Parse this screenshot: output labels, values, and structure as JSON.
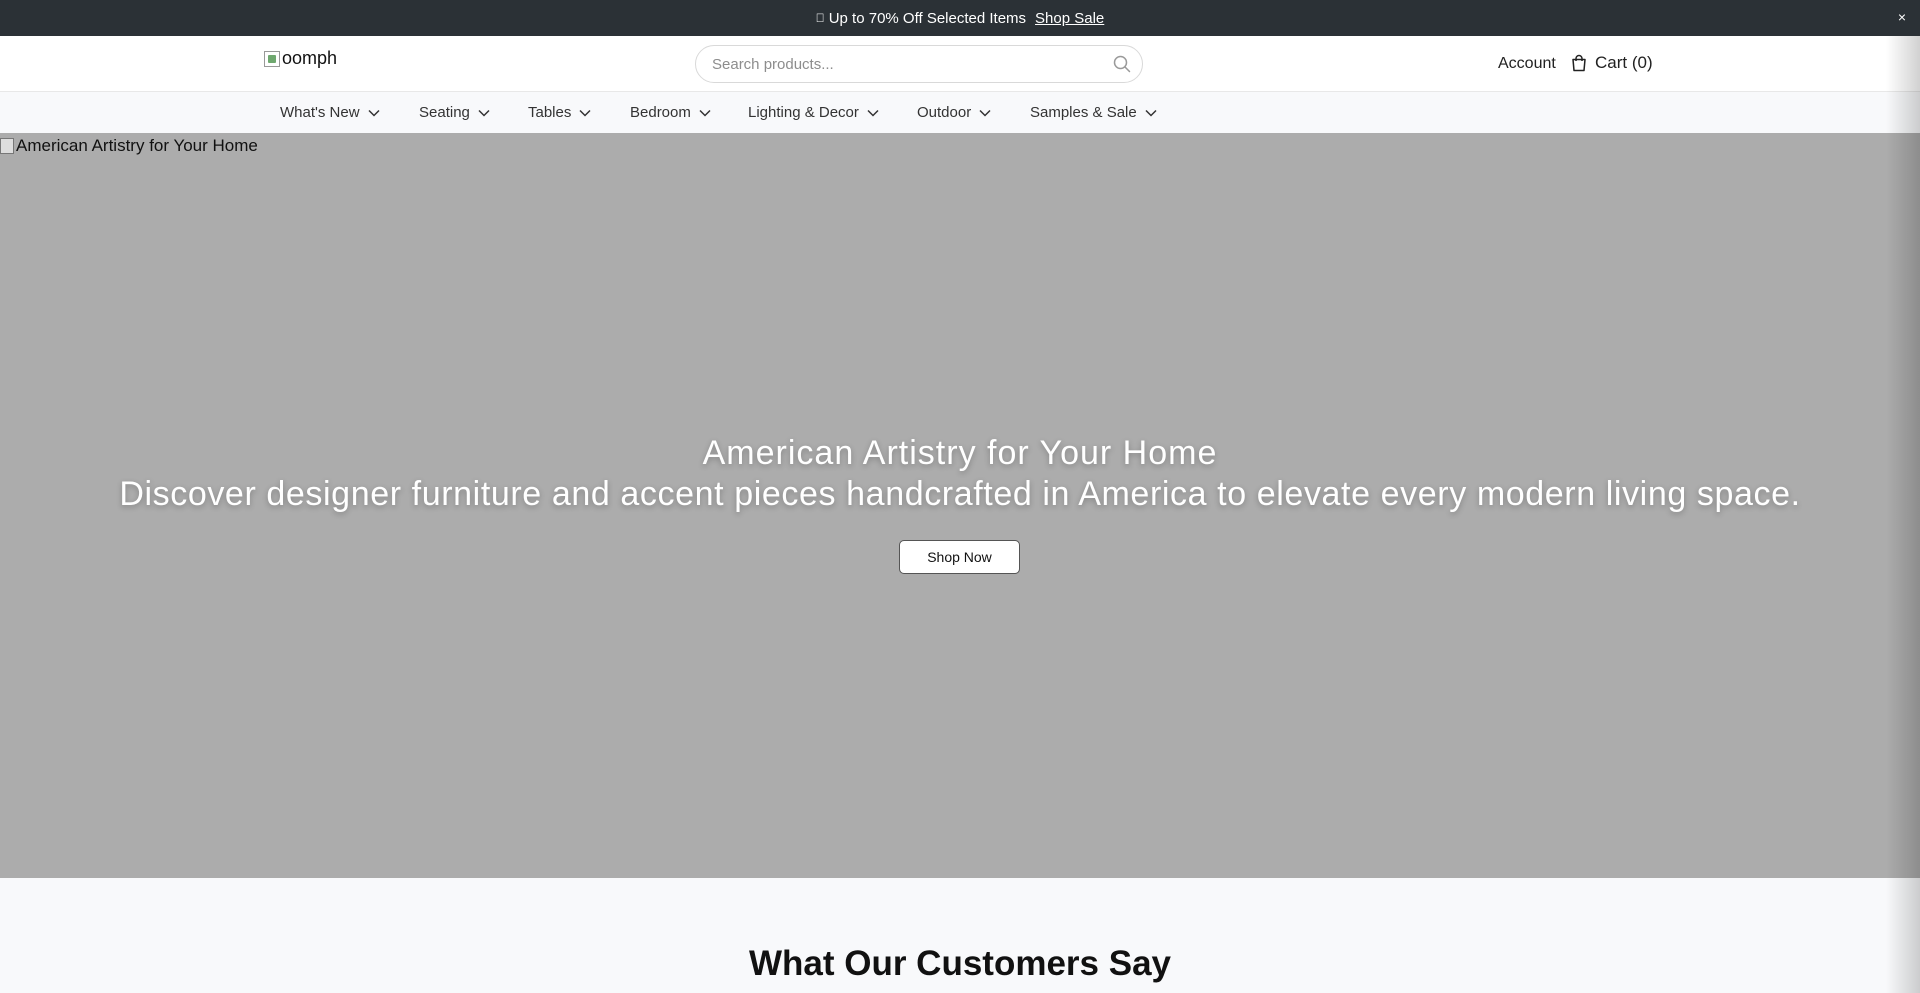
{
  "announcement": {
    "text": "Up to 70% Off Selected Items",
    "link": "Shop Sale",
    "tag_icon": "",
    "close": "×"
  },
  "header": {
    "logo_alt": "oomph",
    "search_placeholder": "Search products...",
    "account": "Account",
    "cart": "Cart (0)"
  },
  "nav": {
    "items": [
      {
        "label": "What's New"
      },
      {
        "label": "Seating"
      },
      {
        "label": "Tables"
      },
      {
        "label": "Bedroom"
      },
      {
        "label": "Lighting & Decor"
      },
      {
        "label": "Outdoor"
      },
      {
        "label": "Samples & Sale"
      }
    ]
  },
  "hero": {
    "image_alt": "American Artistry for Your Home",
    "title": "American Artistry for Your Home",
    "subtitle": "Discover designer furniture and accent pieces handcrafted in America to elevate every modern living space.",
    "cta": "Shop Now"
  },
  "testimonials": {
    "heading": "What Our Customers Say"
  },
  "colors": {
    "announcement_bg": "#2b3136",
    "hero_bg": "#acacac",
    "page_bg": "#f8f9fb"
  }
}
